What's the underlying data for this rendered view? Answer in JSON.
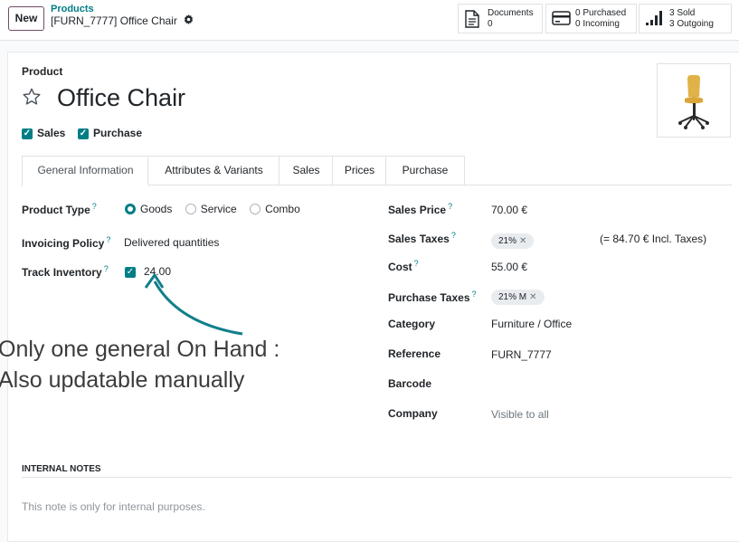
{
  "control_panel": {
    "new_label": "New",
    "breadcrumb_parent": "Products",
    "breadcrumb_current": "[FURN_7777] Office Chair",
    "stats": {
      "documents_label": "Documents",
      "documents_count": "0",
      "purchased": "0 Purchased",
      "incoming": "0 Incoming",
      "sold": "3 Sold",
      "outgoing": "3 Outgoing"
    }
  },
  "product": {
    "section_label": "Product",
    "name": "Office Chair",
    "sales_label": "Sales",
    "purchase_label": "Purchase",
    "sales_checked": true,
    "purchase_checked": true
  },
  "tabs": [
    "General Information",
    "Attributes & Variants",
    "Sales",
    "Prices",
    "Purchase"
  ],
  "active_tab": "General Information",
  "left_fields": {
    "product_type_label": "Product Type",
    "product_type_options": [
      "Goods",
      "Service",
      "Combo"
    ],
    "product_type_selected": "Goods",
    "invoicing_policy_label": "Invoicing Policy",
    "invoicing_policy_value": "Delivered quantities",
    "track_inventory_label": "Track Inventory",
    "track_inventory_value": "24.00",
    "help_mark": "?"
  },
  "right_fields": {
    "sales_price_label": "Sales Price",
    "sales_price_value": "70.00 €",
    "sales_taxes_label": "Sales Taxes",
    "sales_taxes_tag": "21%",
    "incl_taxes_note": "(= 84.70 € Incl. Taxes)",
    "cost_label": "Cost",
    "cost_value": "55.00 €",
    "purchase_taxes_label": "Purchase Taxes",
    "purchase_taxes_tag": "21% M",
    "category_label": "Category",
    "category_value": "Furniture / Office",
    "reference_label": "Reference",
    "reference_value": "FURN_7777",
    "barcode_label": "Barcode",
    "company_label": "Company",
    "company_value": "Visible to all"
  },
  "annotation": {
    "line1": "Only one general On Hand :",
    "line2": "Also updatable manually",
    "arrow_color": "#117f8a"
  },
  "notes": {
    "title": "INTERNAL NOTES",
    "placeholder": "This note is only for internal purposes."
  },
  "colors": {
    "accent": "#017e84",
    "primary_border": "#714b67"
  }
}
